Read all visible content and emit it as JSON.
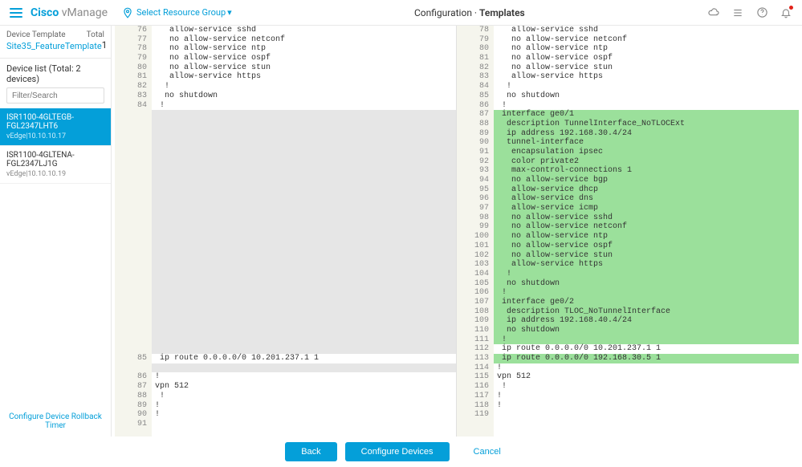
{
  "header": {
    "brand_cisco": "Cisco",
    "brand_vmanage": "vManage",
    "resource_label": "Select Resource Group",
    "title_prefix": "Configuration · ",
    "title_bold": "Templates"
  },
  "sidebar": {
    "device_template_label": "Device Template",
    "total_label": "Total",
    "total_count": "1",
    "template_name": "Site35_FeatureTemplate",
    "device_list_header": "Device list (Total: 2 devices)",
    "filter_placeholder": "Filter/Search",
    "devices": [
      {
        "name": "ISR1100-4GLTEGB-FGL2347LHT6",
        "sub": "vEdge|10.10.10.17",
        "active": true
      },
      {
        "name": "ISR1100-4GLTENA-FGL2347LJ1G",
        "sub": "vEdge|10.10.10.19",
        "active": false
      }
    ],
    "rollback": "Configure Device Rollback Timer"
  },
  "diff": {
    "left": {
      "start": 76,
      "lines": [
        {
          "n": 76,
          "t": "   allow-service sshd",
          "c": ""
        },
        {
          "n": 77,
          "t": "   no allow-service netconf",
          "c": ""
        },
        {
          "n": 78,
          "t": "   no allow-service ntp",
          "c": ""
        },
        {
          "n": 79,
          "t": "   no allow-service ospf",
          "c": ""
        },
        {
          "n": 80,
          "t": "   no allow-service stun",
          "c": ""
        },
        {
          "n": 81,
          "t": "   allow-service https",
          "c": ""
        },
        {
          "n": 82,
          "t": "  !",
          "c": ""
        },
        {
          "n": 83,
          "t": "  no shutdown",
          "c": ""
        },
        {
          "n": 84,
          "t": " !",
          "c": ""
        },
        {
          "n": "",
          "t": "",
          "c": "blank"
        },
        {
          "n": "",
          "t": "",
          "c": "blank"
        },
        {
          "n": "",
          "t": "",
          "c": "blank"
        },
        {
          "n": "",
          "t": "",
          "c": "blank"
        },
        {
          "n": "",
          "t": "",
          "c": "blank"
        },
        {
          "n": "",
          "t": "",
          "c": "blank"
        },
        {
          "n": "",
          "t": "",
          "c": "blank"
        },
        {
          "n": "",
          "t": "",
          "c": "blank"
        },
        {
          "n": "",
          "t": "",
          "c": "blank"
        },
        {
          "n": "",
          "t": "",
          "c": "blank"
        },
        {
          "n": "",
          "t": "",
          "c": "blank"
        },
        {
          "n": "",
          "t": "",
          "c": "blank"
        },
        {
          "n": "",
          "t": "",
          "c": "blank"
        },
        {
          "n": "",
          "t": "",
          "c": "blank"
        },
        {
          "n": "",
          "t": "",
          "c": "blank"
        },
        {
          "n": "",
          "t": "",
          "c": "blank"
        },
        {
          "n": "",
          "t": "",
          "c": "blank"
        },
        {
          "n": "",
          "t": "",
          "c": "blank"
        },
        {
          "n": "",
          "t": "",
          "c": "blank"
        },
        {
          "n": "",
          "t": "",
          "c": "blank"
        },
        {
          "n": "",
          "t": "",
          "c": "blank"
        },
        {
          "n": "",
          "t": "",
          "c": "blank"
        },
        {
          "n": "",
          "t": "",
          "c": "blank"
        },
        {
          "n": "",
          "t": "",
          "c": "blank"
        },
        {
          "n": "",
          "t": "",
          "c": "blank"
        },
        {
          "n": "",
          "t": "",
          "c": "blank"
        },
        {
          "n": 85,
          "t": " ip route 0.0.0.0/0 10.201.237.1 1",
          "c": ""
        },
        {
          "n": "",
          "t": "",
          "c": "blank"
        },
        {
          "n": 86,
          "t": "!",
          "c": ""
        },
        {
          "n": 87,
          "t": "vpn 512",
          "c": ""
        },
        {
          "n": 88,
          "t": " !",
          "c": ""
        },
        {
          "n": 89,
          "t": "!",
          "c": ""
        },
        {
          "n": 90,
          "t": "!",
          "c": ""
        },
        {
          "n": 91,
          "t": "",
          "c": ""
        }
      ]
    },
    "right": {
      "start": 78,
      "lines": [
        {
          "n": 78,
          "t": "   allow-service sshd",
          "c": ""
        },
        {
          "n": 79,
          "t": "   no allow-service netconf",
          "c": ""
        },
        {
          "n": 80,
          "t": "   no allow-service ntp",
          "c": ""
        },
        {
          "n": 81,
          "t": "   no allow-service ospf",
          "c": ""
        },
        {
          "n": 82,
          "t": "   no allow-service stun",
          "c": ""
        },
        {
          "n": 83,
          "t": "   allow-service https",
          "c": ""
        },
        {
          "n": 84,
          "t": "  !",
          "c": ""
        },
        {
          "n": 85,
          "t": "  no shutdown",
          "c": ""
        },
        {
          "n": 86,
          "t": " !",
          "c": ""
        },
        {
          "n": 87,
          "t": " interface ge0/1",
          "c": "added"
        },
        {
          "n": 88,
          "t": "  description TunnelInterface_NoTLOCExt",
          "c": "added"
        },
        {
          "n": 89,
          "t": "  ip address 192.168.30.4/24",
          "c": "added"
        },
        {
          "n": 90,
          "t": "  tunnel-interface",
          "c": "added"
        },
        {
          "n": 91,
          "t": "   encapsulation ipsec",
          "c": "added"
        },
        {
          "n": 92,
          "t": "   color private2",
          "c": "added"
        },
        {
          "n": 93,
          "t": "   max-control-connections 1",
          "c": "added"
        },
        {
          "n": 94,
          "t": "   no allow-service bgp",
          "c": "added"
        },
        {
          "n": 95,
          "t": "   allow-service dhcp",
          "c": "added"
        },
        {
          "n": 96,
          "t": "   allow-service dns",
          "c": "added"
        },
        {
          "n": 97,
          "t": "   allow-service icmp",
          "c": "added"
        },
        {
          "n": 98,
          "t": "   no allow-service sshd",
          "c": "added"
        },
        {
          "n": 99,
          "t": "   no allow-service netconf",
          "c": "added"
        },
        {
          "n": 100,
          "t": "   no allow-service ntp",
          "c": "added"
        },
        {
          "n": 101,
          "t": "   no allow-service ospf",
          "c": "added"
        },
        {
          "n": 102,
          "t": "   no allow-service stun",
          "c": "added"
        },
        {
          "n": 103,
          "t": "   allow-service https",
          "c": "added"
        },
        {
          "n": 104,
          "t": "  !",
          "c": "added"
        },
        {
          "n": 105,
          "t": "  no shutdown",
          "c": "added"
        },
        {
          "n": 106,
          "t": " !",
          "c": "added"
        },
        {
          "n": 107,
          "t": " interface ge0/2",
          "c": "added"
        },
        {
          "n": 108,
          "t": "  description TLOC_NoTunnelInterface",
          "c": "added"
        },
        {
          "n": 109,
          "t": "  ip address 192.168.40.4/24",
          "c": "added"
        },
        {
          "n": 110,
          "t": "  no shutdown",
          "c": "added"
        },
        {
          "n": 111,
          "t": " !",
          "c": "added"
        },
        {
          "n": 112,
          "t": " ip route 0.0.0.0/0 10.201.237.1 1",
          "c": ""
        },
        {
          "n": 113,
          "t": " ip route 0.0.0.0/0 192.168.30.5 1",
          "c": "added"
        },
        {
          "n": 114,
          "t": "!",
          "c": ""
        },
        {
          "n": 115,
          "t": "vpn 512",
          "c": ""
        },
        {
          "n": 116,
          "t": " !",
          "c": ""
        },
        {
          "n": 117,
          "t": "!",
          "c": ""
        },
        {
          "n": 118,
          "t": "!",
          "c": ""
        },
        {
          "n": 119,
          "t": "",
          "c": ""
        }
      ]
    }
  },
  "footer": {
    "back": "Back",
    "configure": "Configure Devices",
    "cancel": "Cancel"
  }
}
